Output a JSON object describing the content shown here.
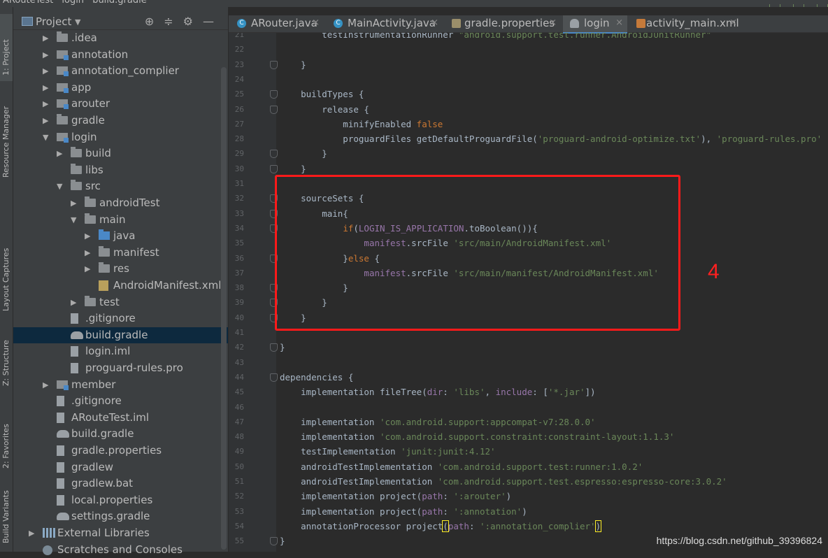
{
  "titlebar": {
    "project": "ARouteTest",
    "module": "login",
    "file": "build.gradle"
  },
  "toolstrip": {
    "tabs": [
      {
        "label": "1: Project"
      },
      {
        "label": "Resource Manager"
      },
      {
        "label": "Layout Captures"
      },
      {
        "label": "Z: Structure"
      },
      {
        "label": "2: Favorites"
      },
      {
        "label": "Build Variants"
      }
    ]
  },
  "project_panel": {
    "title": "Project",
    "tree": [
      {
        "label": ".idea",
        "icon": "folder-icon",
        "arrow": "▶"
      },
      {
        "label": "annotation",
        "icon": "module-icon",
        "arrow": "▶"
      },
      {
        "label": "annotation_complier",
        "icon": "module-icon",
        "arrow": "▶"
      },
      {
        "label": "app",
        "icon": "module-icon",
        "arrow": "▶"
      },
      {
        "label": "arouter",
        "icon": "module-icon",
        "arrow": "▶"
      },
      {
        "label": "gradle",
        "icon": "folder-icon",
        "arrow": "▶"
      },
      {
        "label": "login",
        "icon": "module-icon",
        "arrow": "▼"
      },
      {
        "label": "build",
        "icon": "folder-icon",
        "arrow": "▶"
      },
      {
        "label": "libs",
        "icon": "folder-icon",
        "arrow": ""
      },
      {
        "label": "src",
        "icon": "folder-icon",
        "arrow": "▼"
      },
      {
        "label": "androidTest",
        "icon": "folder-icon",
        "arrow": "▶"
      },
      {
        "label": "main",
        "icon": "folder-icon",
        "arrow": "▼"
      },
      {
        "label": "java",
        "icon": "source-folder-icon",
        "arrow": "▶"
      },
      {
        "label": "manifest",
        "icon": "folder-icon",
        "arrow": "▶"
      },
      {
        "label": "res",
        "icon": "resource-folder-icon",
        "arrow": "▶"
      },
      {
        "label": "AndroidManifest.xml",
        "icon": "manifest-file-icon",
        "arrow": ""
      },
      {
        "label": "test",
        "icon": "folder-icon",
        "arrow": "▶"
      },
      {
        "label": ".gitignore",
        "icon": "text-file-icon",
        "arrow": ""
      },
      {
        "label": "build.gradle",
        "icon": "gradle-icon",
        "arrow": ""
      },
      {
        "label": "login.iml",
        "icon": "iml-file-icon",
        "arrow": ""
      },
      {
        "label": "proguard-rules.pro",
        "icon": "text-file-icon",
        "arrow": ""
      },
      {
        "label": "member",
        "icon": "module-icon",
        "arrow": "▶"
      },
      {
        "label": ".gitignore",
        "icon": "text-file-icon",
        "arrow": ""
      },
      {
        "label": "ARouteTest.iml",
        "icon": "iml-file-icon",
        "arrow": ""
      },
      {
        "label": "build.gradle",
        "icon": "gradle-icon",
        "arrow": ""
      },
      {
        "label": "gradle.properties",
        "icon": "properties-file-icon",
        "arrow": ""
      },
      {
        "label": "gradlew",
        "icon": "text-file-icon",
        "arrow": ""
      },
      {
        "label": "gradlew.bat",
        "icon": "text-file-icon",
        "arrow": ""
      },
      {
        "label": "local.properties",
        "icon": "properties-file-icon",
        "arrow": ""
      },
      {
        "label": "settings.gradle",
        "icon": "gradle-icon",
        "arrow": ""
      },
      {
        "label": "External Libraries",
        "icon": "libraries-icon",
        "arrow": "▶"
      },
      {
        "label": "Scratches and Consoles",
        "icon": "scratch-icon",
        "arrow": ""
      }
    ],
    "selected_item": "build.gradle"
  },
  "editor": {
    "tabs": [
      {
        "label": "ARouter.java",
        "icon": "C",
        "close": "×"
      },
      {
        "label": "MainActivity.java",
        "icon": "C",
        "close": "×"
      },
      {
        "label": "gradle.properties",
        "icon": "",
        "close": "×"
      },
      {
        "label": "login",
        "icon": "",
        "close": "×"
      },
      {
        "label": "activity_main.xml",
        "icon": "",
        "close": "×"
      }
    ],
    "active_tab": "login",
    "annotation_number": "4",
    "lines": [
      {
        "n": "21",
        "html": "        testInstrumentationRunner <span class=\"s\">\"android.support.test.runner.AndroidJUnitRunner\"</span>"
      },
      {
        "n": "22",
        "html": ""
      },
      {
        "n": "23",
        "html": "    }"
      },
      {
        "n": "24",
        "html": ""
      },
      {
        "n": "25",
        "html": "    buildTypes {"
      },
      {
        "n": "26",
        "html": "        release {"
      },
      {
        "n": "27",
        "html": "            minifyEnabled <span class=\"k\">false</span>"
      },
      {
        "n": "28",
        "html": "            proguardFiles getDefaultProguardFile(<span class=\"s\">'proguard-android-optimize.txt'</span>), <span class=\"s\">'proguard-rules.pro'</span>"
      },
      {
        "n": "29",
        "html": "        }"
      },
      {
        "n": "30",
        "html": "    }"
      },
      {
        "n": "31",
        "html": ""
      },
      {
        "n": "32",
        "html": "    sourceSets {"
      },
      {
        "n": "33",
        "html": "        main{"
      },
      {
        "n": "34",
        "html": "            <span class=\"k\">if</span>(<span class=\"p\">LOGIN_IS_APPLICATION</span>.toBoolean()){"
      },
      {
        "n": "35",
        "html": "                <span class=\"p\">manifest</span>.srcFile <span class=\"s\">'src/main/AndroidManifest.xml'</span>"
      },
      {
        "n": "36",
        "html": "            }<span class=\"k\">else</span> {"
      },
      {
        "n": "37",
        "html": "                <span class=\"p\">manifest</span>.srcFile <span class=\"s\">'src/main/manifest/AndroidManifest.xml'</span>"
      },
      {
        "n": "38",
        "html": "            }"
      },
      {
        "n": "39",
        "html": "        }"
      },
      {
        "n": "40",
        "html": "    }"
      },
      {
        "n": "41",
        "html": ""
      },
      {
        "n": "42",
        "html": "}"
      },
      {
        "n": "43",
        "html": ""
      },
      {
        "n": "44",
        "html": "dependencies {"
      },
      {
        "n": "45",
        "html": "    implementation fileTree(<span class=\"p\">dir</span>: <span class=\"s\">'libs'</span>, <span class=\"p\">include</span>: [<span class=\"s\">'*.jar'</span>])"
      },
      {
        "n": "46",
        "html": ""
      },
      {
        "n": "47",
        "html": "    implementation <span class=\"s\">'com.android.support:appcompat-v7:28.0.0'</span>"
      },
      {
        "n": "48",
        "html": "    implementation <span class=\"s\">'com.android.support.constraint:constraint-layout:1.1.3'</span>"
      },
      {
        "n": "49",
        "html": "    testImplementation <span class=\"s\">'junit:junit:4.12'</span>"
      },
      {
        "n": "50",
        "html": "    androidTestImplementation <span class=\"s\">'com.android.support.test:runner:1.0.2'</span>"
      },
      {
        "n": "51",
        "html": "    androidTestImplementation <span class=\"s\">'com.android.support.test.espresso:espresso-core:3.0.2'</span>"
      },
      {
        "n": "52",
        "html": "    implementation project(<span class=\"p\">path</span>: <span class=\"s\">':arouter'</span>)"
      },
      {
        "n": "53",
        "html": "    implementation project(<span class=\"p\">path</span>: <span class=\"s\">':annotation'</span>)"
      },
      {
        "n": "54",
        "html": "    annotationProcessor project<span class=\"bracematch\">(</span><span class=\"p\">path</span>: <span class=\"s\">':annotation_complier'</span><span class=\"bracematch\">)</span>"
      },
      {
        "n": "55",
        "html": "}"
      }
    ]
  },
  "watermark": "https://blog.csdn.net/github_39396824"
}
